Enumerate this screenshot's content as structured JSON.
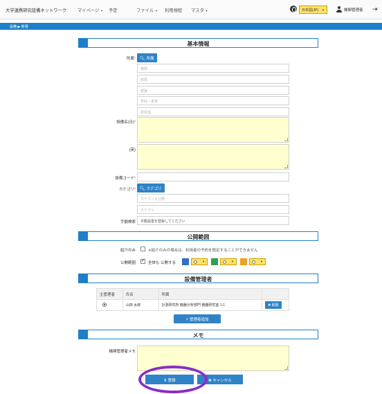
{
  "nav": {
    "brand": "大学連携研究設備ネットワーク",
    "items": [
      {
        "label": "マイページ",
        "caret": "▼"
      },
      {
        "label": "予定",
        "caret": ""
      },
      {
        "label": "ファイル",
        "caret": "▼"
      },
      {
        "label": "利用規程",
        "caret": ""
      },
      {
        "label": "マスタ",
        "caret": "▼"
      }
    ],
    "language": "日本語(JP)",
    "language_caret": "▼",
    "user_name": "機関管理者",
    "logout_glyph": "⇥"
  },
  "breadcrumb": "設備 ▶ 新規",
  "sections": {
    "basic": "基本情報",
    "scope": "公開範囲",
    "managers": "設備管理者",
    "memo": "メモ"
  },
  "basic": {
    "location_label": "所属",
    "location_button": "所属",
    "location_placeholders": [
      "機関",
      "部局",
      "部署",
      "学科・専攻",
      "研究室"
    ],
    "name_jp_label": "設備名(日)",
    "name_en_label": "(英)",
    "code_label": "設備コード",
    "category_label": "カテゴリ",
    "category_button": "カテゴリ",
    "category_placeholders": [
      "カテゴリ大分類",
      "カテゴリ"
    ],
    "location_place_label": "手動検索",
    "location_place_value": "手動設置を登録してください"
  },
  "scope": {
    "intro_label": "紹介のみ",
    "intro_text": "※紹介のみの場合は、利用者の予約を設定することができません",
    "publish_label": "公開範囲",
    "publish_text": "全体も 公開する"
  },
  "managers": {
    "headers": [
      "主管理者",
      "氏名",
      "所属",
      ""
    ],
    "rows": [
      {
        "name": "山田 太郎",
        "affiliation": "計測研究所 機器分析部門 機器研究室 1-1",
        "delete_label": "削除"
      }
    ],
    "add_button": "管理者追加"
  },
  "memo": {
    "label": "機関管理者メモ"
  },
  "actions": {
    "submit": "登録",
    "cancel": "キャンセル"
  },
  "colors": {
    "accent": "#1f7fc8",
    "required": "#e53935",
    "yellow_field": "#ffffd0",
    "annotation": "#8a2ec4"
  }
}
